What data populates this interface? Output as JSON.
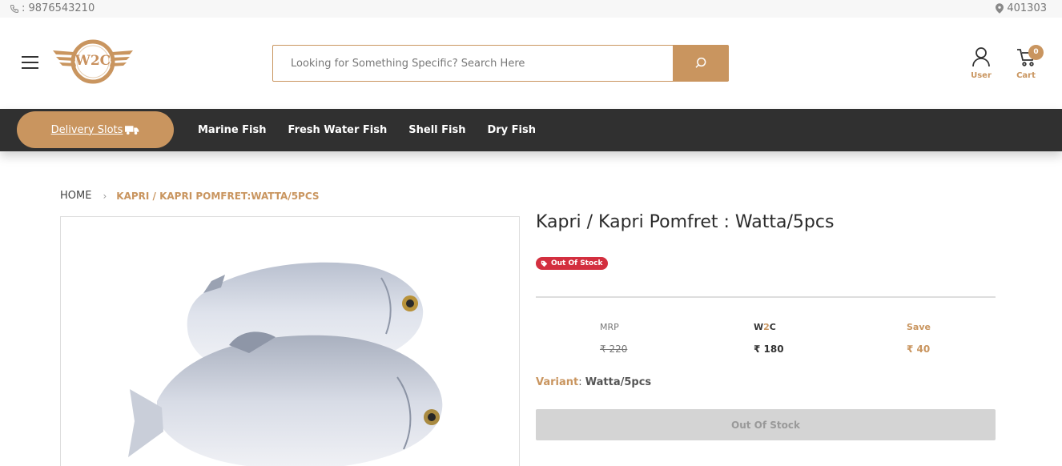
{
  "top_strip": {
    "phone": ": 9876543210",
    "pincode": "401303"
  },
  "header": {
    "logo_text": "W2C",
    "search_placeholder": "Looking for Something Specific? Search Here",
    "user_label": "User",
    "cart_label": "Cart",
    "cart_count": "0"
  },
  "nav": {
    "delivery_slots": "Delivery Slots",
    "links": [
      "Marine Fish",
      "Fresh Water Fish",
      "Shell Fish",
      "Dry Fish"
    ]
  },
  "breadcrumb": {
    "home": "HOME",
    "current": "KAPRI / KAPRI POMFRET:WATTA/5PCS"
  },
  "product": {
    "title": "Kapri / Kapri Pomfret : Watta/5pcs",
    "stock_badge": "Out Of Stock",
    "mrp_label": "MRP",
    "mrp_value": "₹ 220",
    "w2c_label_a": "W",
    "w2c_label_b": "2",
    "w2c_label_c": "C",
    "w2c_value": "₹ 180",
    "save_label": "Save",
    "save_value": "₹ 40",
    "variant_key": "Variant",
    "variant_value": "Watta/5pcs",
    "button_label": "Out Of Stock"
  },
  "colors": {
    "accent": "#c9955f",
    "navbar": "#303030",
    "badge_red": "#d32f3f",
    "disabled_btn": "#d4d4d4"
  },
  "icons": [
    "phone-icon",
    "map-pin-icon",
    "menu-icon",
    "search-icon",
    "user-icon",
    "cart-icon",
    "truck-icon",
    "tag-icon",
    "chevron-right-icon"
  ]
}
